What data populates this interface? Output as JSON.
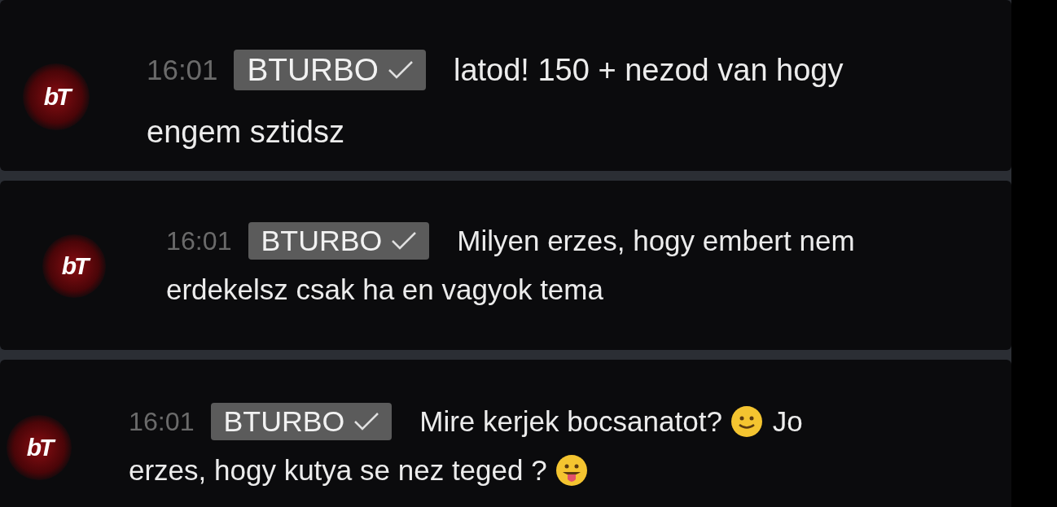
{
  "messages": [
    {
      "avatar_text": "bT",
      "time": "16:01",
      "author": "BTURBO",
      "verified": true,
      "lines": [
        [
          {
            "kind": "text",
            "text": "latod! 150 + nezod van hogy"
          }
        ],
        [
          {
            "kind": "text",
            "text": "engem sztidsz"
          }
        ]
      ]
    },
    {
      "avatar_text": "bT",
      "time": "16:01",
      "author": "BTURBO",
      "verified": true,
      "lines": [
        [
          {
            "kind": "text",
            "text": "Milyen erzes, hogy embert nem"
          }
        ],
        [
          {
            "kind": "text",
            "text": "erdekelsz csak ha en vagyok tema"
          }
        ]
      ]
    },
    {
      "avatar_text": "bT",
      "time": "16:01",
      "author": "BTURBO",
      "verified": true,
      "lines": [
        [
          {
            "kind": "text",
            "text": "Mire kerjek bocsanatot?"
          },
          {
            "kind": "smile"
          },
          {
            "kind": "text",
            "text": "Jo"
          }
        ],
        [
          {
            "kind": "text",
            "text": "erzes, hogy kutya se nez teged ?"
          },
          {
            "kind": "tongue"
          }
        ]
      ]
    }
  ]
}
